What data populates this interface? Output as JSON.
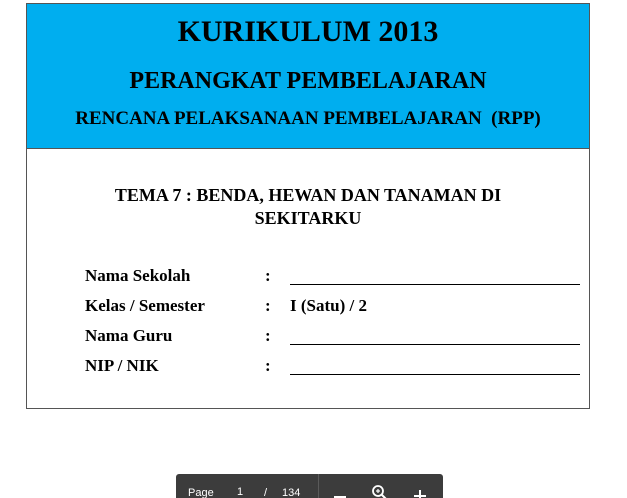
{
  "document": {
    "title": "KURIKULUM 2013",
    "subtitle": "PERANGKAT PEMBELAJARAN",
    "subtitle2": "RENCANA PELAKSANAAN PEMBELAJARAN  (RPP)",
    "theme": "TEMA 7 : BENDA, HEWAN DAN TANAMAN DI SEKITARKU",
    "fields": [
      {
        "label": "Nama Sekolah",
        "colon": ":",
        "value": ""
      },
      {
        "label": "Kelas / Semester",
        "colon": ":",
        "value": "I (Satu) / 2"
      },
      {
        "label": "Nama Guru",
        "colon": ":",
        "value": ""
      },
      {
        "label": "NIP / NIK",
        "colon": ":",
        "value": ""
      }
    ]
  },
  "pager": {
    "label": "Page",
    "current": "1",
    "separator": "/",
    "total": "134"
  },
  "colors": {
    "header_band": "#00aeef",
    "toolbar": "#3c3c3c"
  },
  "icons": {
    "zoom_out": "minus-icon",
    "zoom_reset": "magnifier-icon",
    "zoom_in": "plus-icon"
  }
}
